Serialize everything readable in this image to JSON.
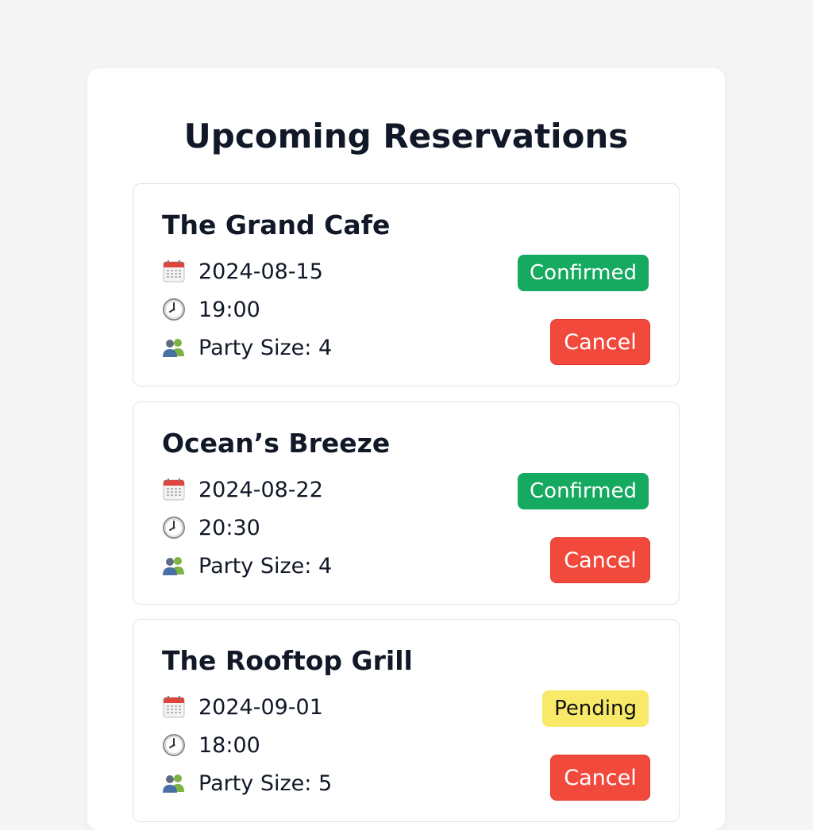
{
  "page": {
    "title": "Upcoming Reservations"
  },
  "labels": {
    "party_prefix": "Party Size: "
  },
  "colors": {
    "confirmed": "#16a960",
    "pending": "#f8ea68",
    "cancel": "#f2493d"
  },
  "icons": {
    "date": "calendar-icon",
    "time": "clock-icon",
    "party": "people-icon"
  },
  "reservations": [
    {
      "name": "The Grand Cafe",
      "date": "2024-08-15",
      "time": "19:00",
      "party_size": "Party Size: 4",
      "status": "Confirmed",
      "cancel_label": "Cancel"
    },
    {
      "name": "Ocean’s Breeze",
      "date": "2024-08-22",
      "time": "20:30",
      "party_size": "Party Size: 4",
      "status": "Confirmed",
      "cancel_label": "Cancel"
    },
    {
      "name": "The Rooftop Grill",
      "date": "2024-09-01",
      "time": "18:00",
      "party_size": "Party Size: 5",
      "status": "Pending",
      "cancel_label": "Cancel"
    }
  ]
}
